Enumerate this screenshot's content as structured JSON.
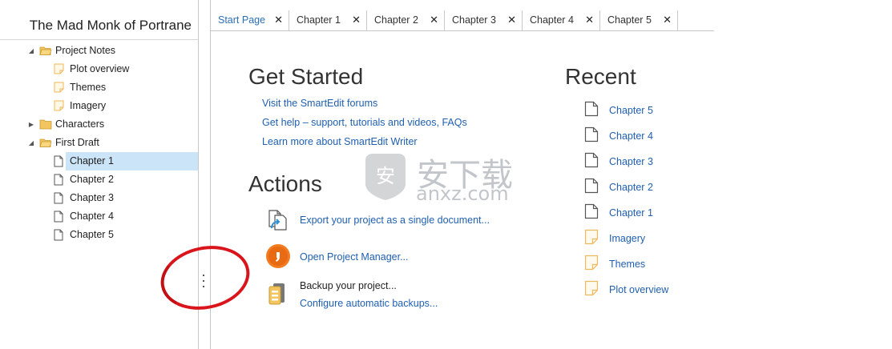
{
  "project": {
    "title": "The Mad Monk of Portrane"
  },
  "tree": {
    "project_notes": "Project Notes",
    "plot_overview": "Plot overview",
    "themes": "Themes",
    "imagery": "Imagery",
    "characters": "Characters",
    "first_draft": "First Draft",
    "chapters": [
      "Chapter 1",
      "Chapter 2",
      "Chapter 3",
      "Chapter 4",
      "Chapter 5"
    ]
  },
  "tabs": [
    {
      "label": "Start Page",
      "close": "✕"
    },
    {
      "label": "Chapter 1",
      "close": "✕"
    },
    {
      "label": "Chapter 2",
      "close": "✕"
    },
    {
      "label": "Chapter 3",
      "close": "✕"
    },
    {
      "label": "Chapter 4",
      "close": "✕"
    },
    {
      "label": "Chapter 5",
      "close": "✕"
    }
  ],
  "get_started": {
    "heading": "Get Started",
    "links": [
      "Visit the SmartEdit forums",
      "Get help – support, tutorials and videos, FAQs",
      "Learn more about SmartEdit Writer"
    ]
  },
  "actions": {
    "heading": "Actions",
    "export": "Export your project as a single document...",
    "manager": "Open Project Manager...",
    "backup": "Backup your project...",
    "configure": "Configure automatic backups..."
  },
  "recent": {
    "heading": "Recent",
    "items": [
      {
        "label": "Chapter 5",
        "icon": "document-icon"
      },
      {
        "label": "Chapter 4",
        "icon": "document-icon"
      },
      {
        "label": "Chapter 3",
        "icon": "document-icon"
      },
      {
        "label": "Chapter 2",
        "icon": "document-icon"
      },
      {
        "label": "Chapter 1",
        "icon": "document-icon"
      },
      {
        "label": "Imagery",
        "icon": "note-icon"
      },
      {
        "label": "Themes",
        "icon": "note-icon"
      },
      {
        "label": "Plot overview",
        "icon": "note-icon"
      }
    ]
  },
  "watermark": {
    "line1": "安下载",
    "line2": "anxz.com"
  },
  "colors": {
    "accent": "#1f5fb0",
    "selection": "#cce4f7",
    "annotation": "#d9151b",
    "note": "#f0b85a"
  }
}
